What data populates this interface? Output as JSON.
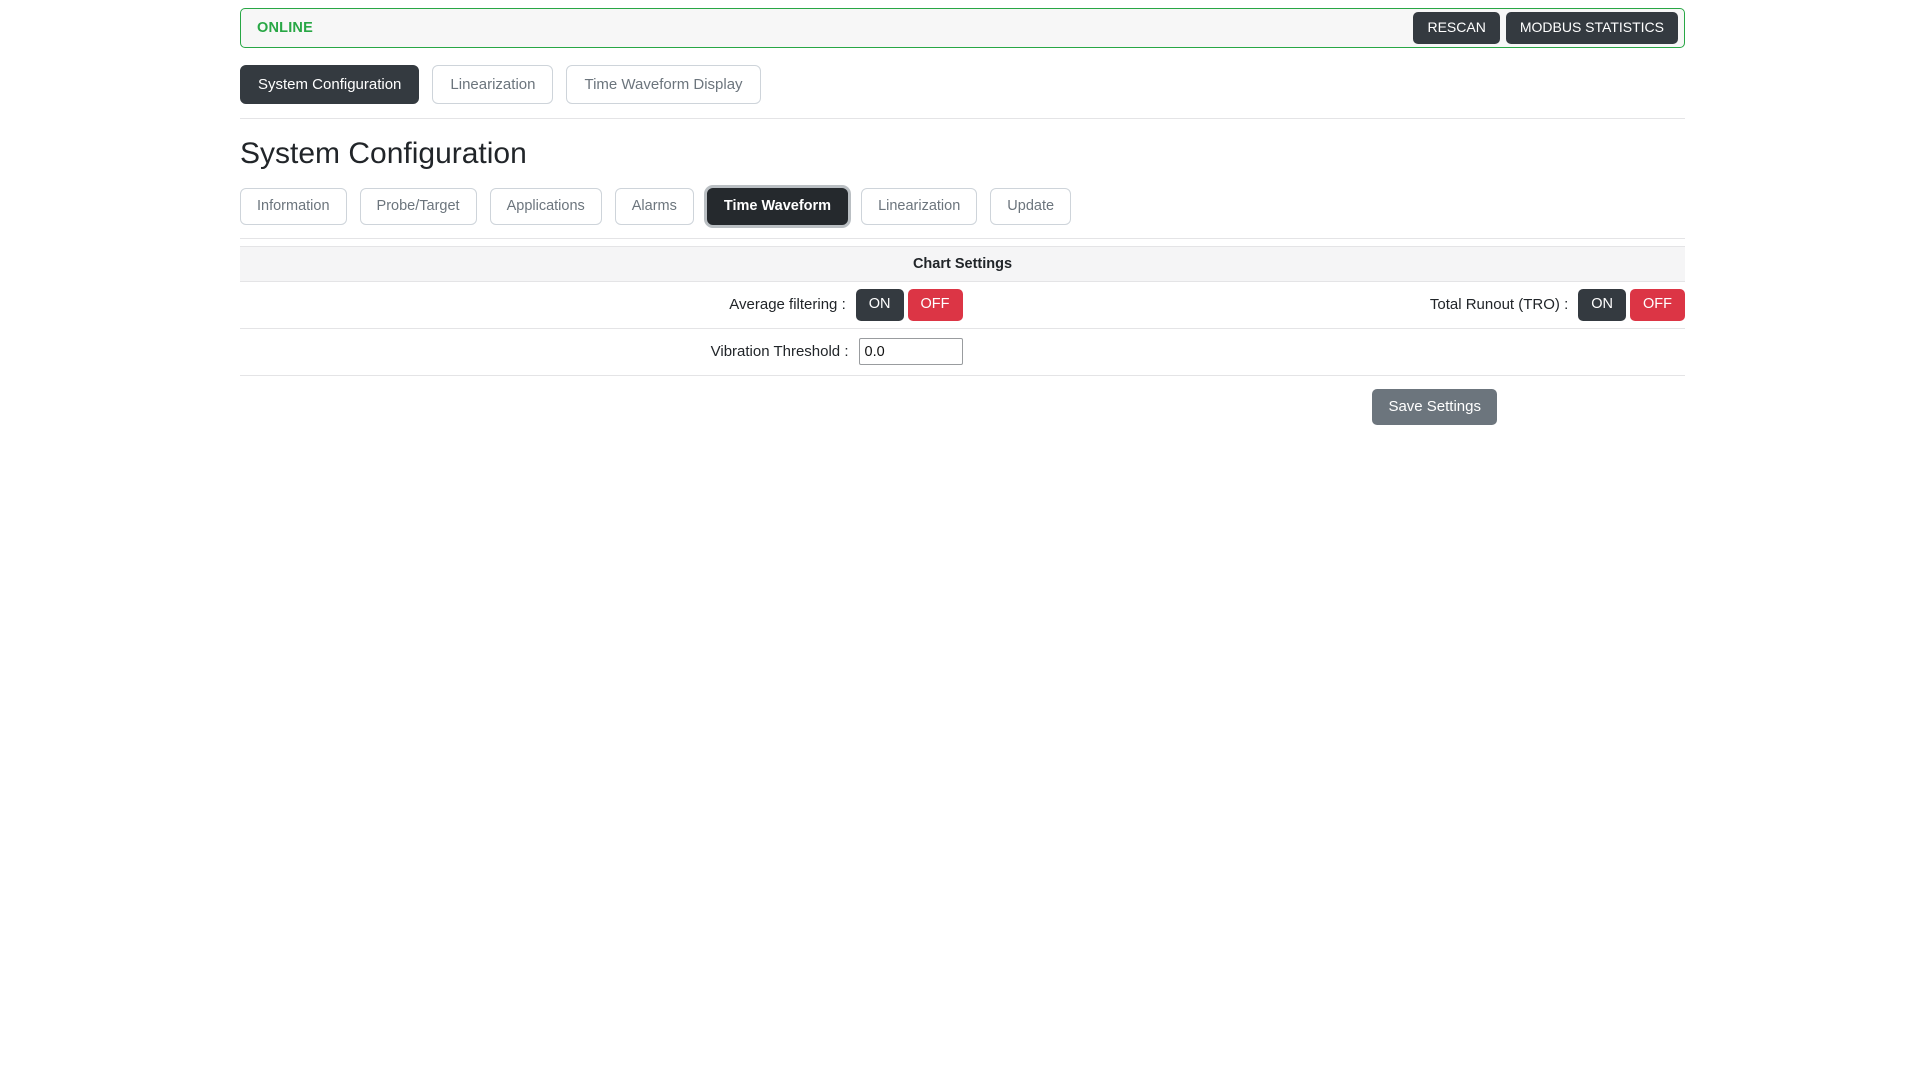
{
  "status_banner": {
    "status_label": "ONLINE",
    "status_color": "#28a745",
    "rescan_label": "RESCAN",
    "modbus_label": "MODBUS STATISTICS"
  },
  "main_nav": {
    "tabs": [
      {
        "label": "System Configuration",
        "active": true
      },
      {
        "label": "Linearization",
        "active": false
      },
      {
        "label": "Time Waveform Display",
        "active": false
      }
    ]
  },
  "page": {
    "title": "System Configuration"
  },
  "sub_nav": {
    "tabs": [
      {
        "label": "Information",
        "active": false
      },
      {
        "label": "Probe/Target",
        "active": false
      },
      {
        "label": "Applications",
        "active": false
      },
      {
        "label": "Alarms",
        "active": false
      },
      {
        "label": "Time Waveform",
        "active": true
      },
      {
        "label": "Linearization",
        "active": false
      },
      {
        "label": "Update",
        "active": false
      }
    ]
  },
  "chart_settings": {
    "header": "Chart Settings",
    "average_filtering": {
      "label": "Average filtering :",
      "on_label": "ON",
      "off_label": "OFF",
      "selected": "OFF"
    },
    "total_runout": {
      "label": "Total Runout (TRO) :",
      "on_label": "ON",
      "off_label": "OFF",
      "selected": "OFF"
    },
    "vibration_threshold": {
      "label": "Vibration Threshold :",
      "value": "0.0"
    },
    "save_label": "Save Settings"
  },
  "colors": {
    "dark": "#343a40",
    "red": "#dc3545",
    "green": "#28a745",
    "grey": "#6c757d"
  }
}
